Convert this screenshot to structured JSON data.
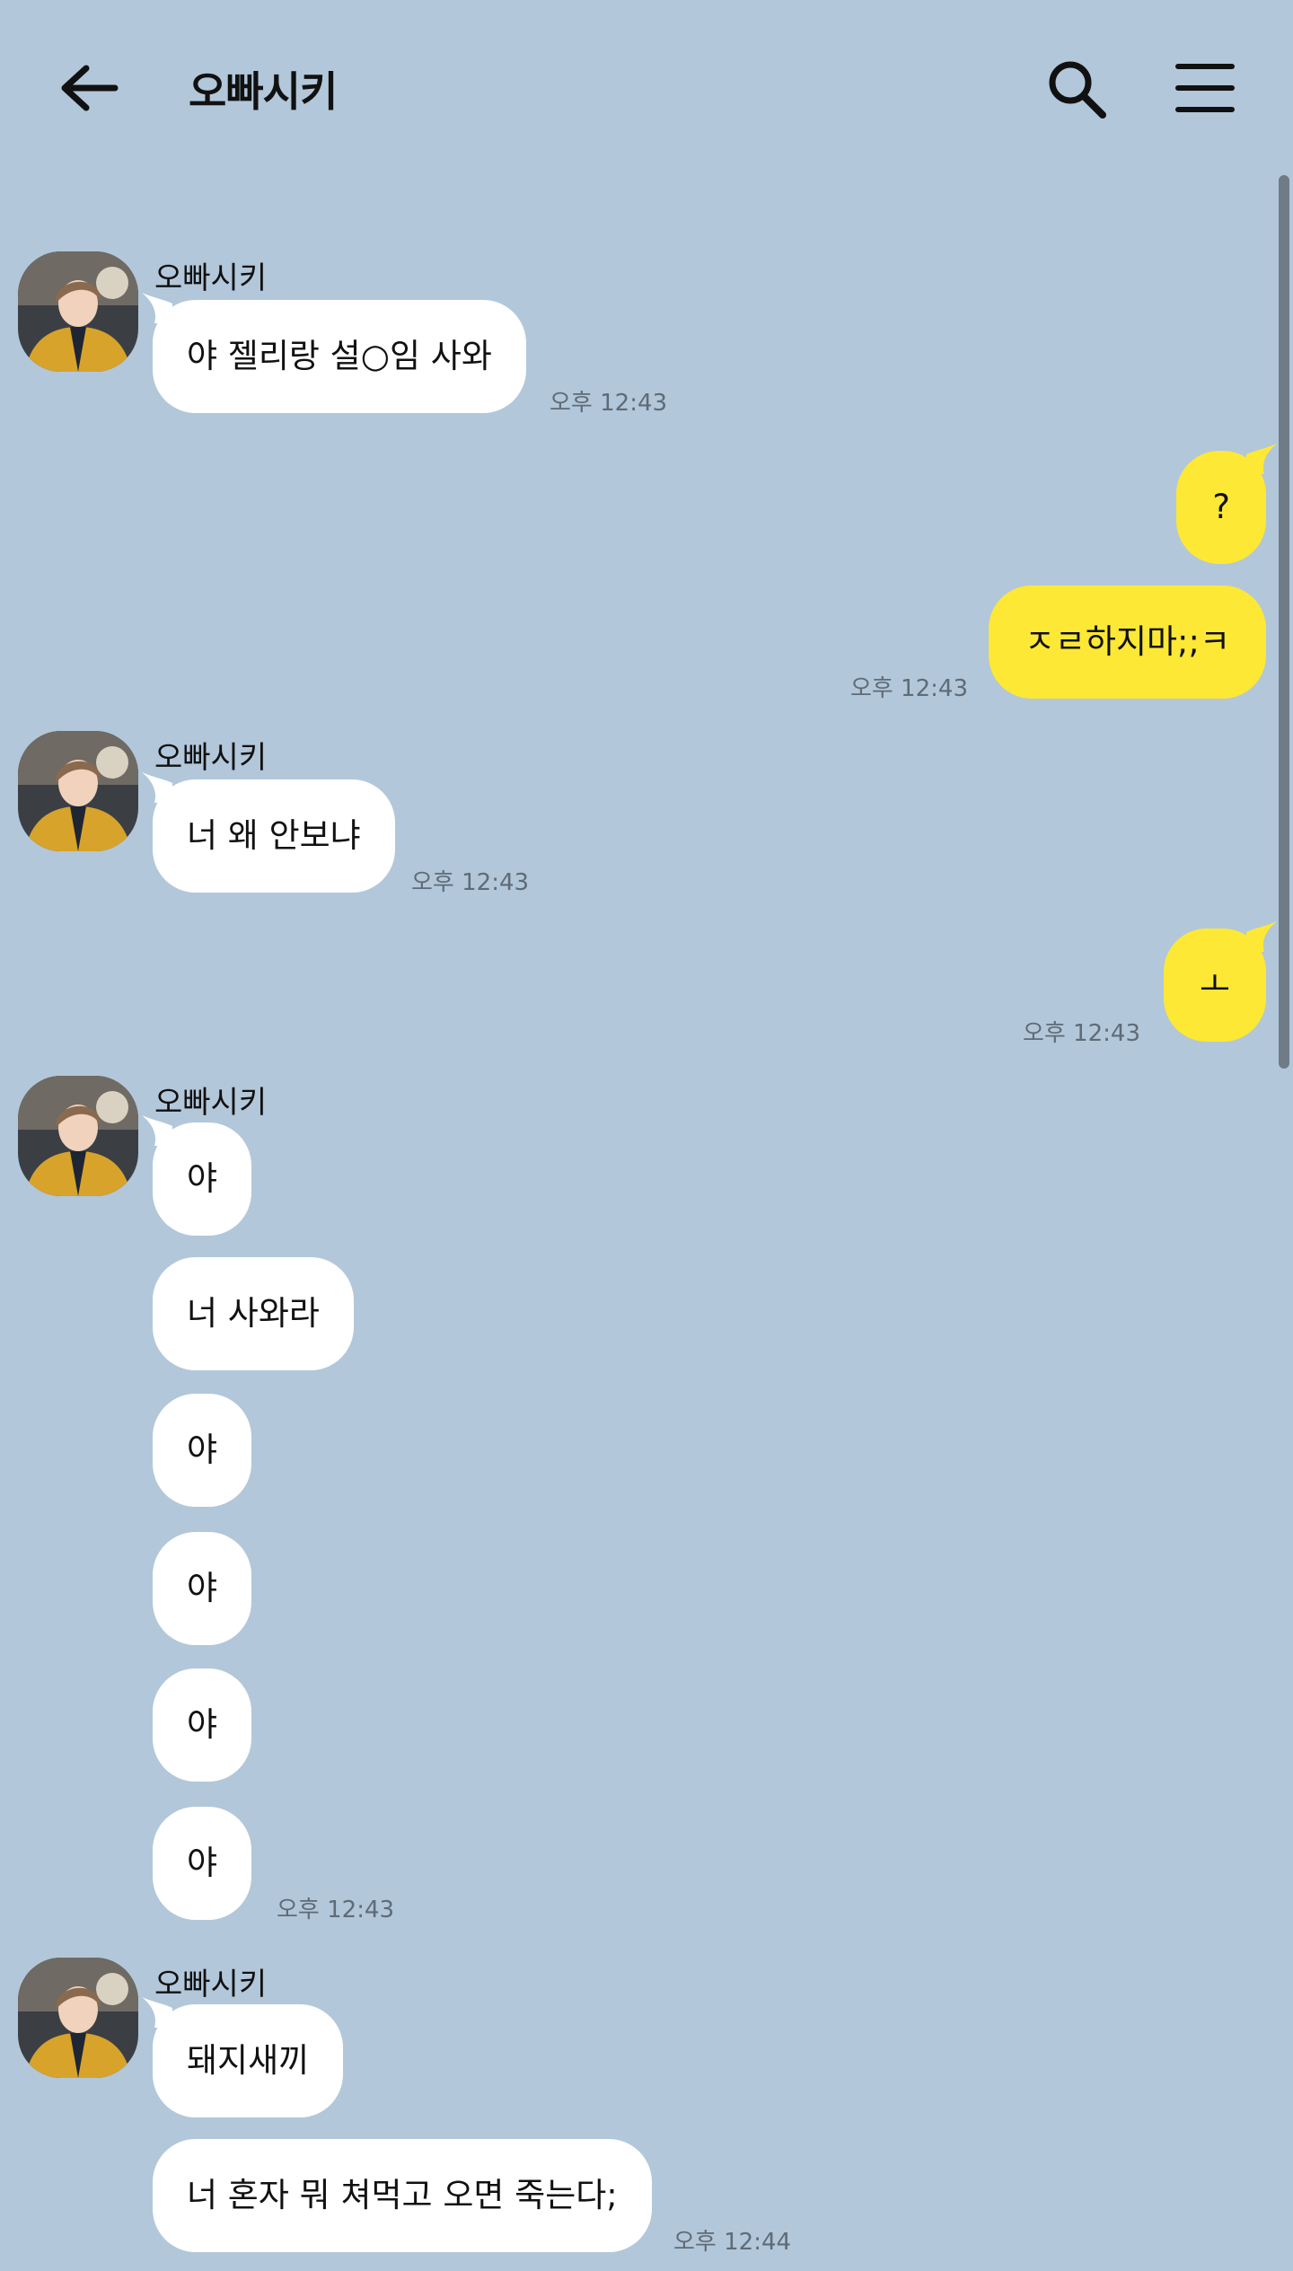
{
  "header": {
    "title": "오빠시키"
  },
  "messages": [
    {
      "sender": "오빠시키",
      "text": "야 젤리랑 설○임 사와",
      "time": "오후 12:43"
    },
    {
      "text": "?"
    },
    {
      "text": "ㅈㄹ하지마;;ㅋ",
      "time": "오후 12:43"
    },
    {
      "sender": "오빠시키",
      "text": "너 왜 안보냐",
      "time": "오후 12:43"
    },
    {
      "text": "ㅗ",
      "time": "오후 12:43"
    },
    {
      "sender": "오빠시키",
      "text": "야"
    },
    {
      "text": "너 사와라"
    },
    {
      "text": "야"
    },
    {
      "text": "야"
    },
    {
      "text": "야"
    },
    {
      "text": "야",
      "time": "오후 12:43"
    },
    {
      "sender": "오빠시키",
      "text": "돼지새끼"
    },
    {
      "text": "너 혼자 뭐 쳐먹고 오면 죽는다;",
      "time": "오후 12:44"
    }
  ],
  "colors": {
    "background": "#b2c7da",
    "incoming_bubble": "#ffffff",
    "outgoing_bubble": "#fde835"
  }
}
